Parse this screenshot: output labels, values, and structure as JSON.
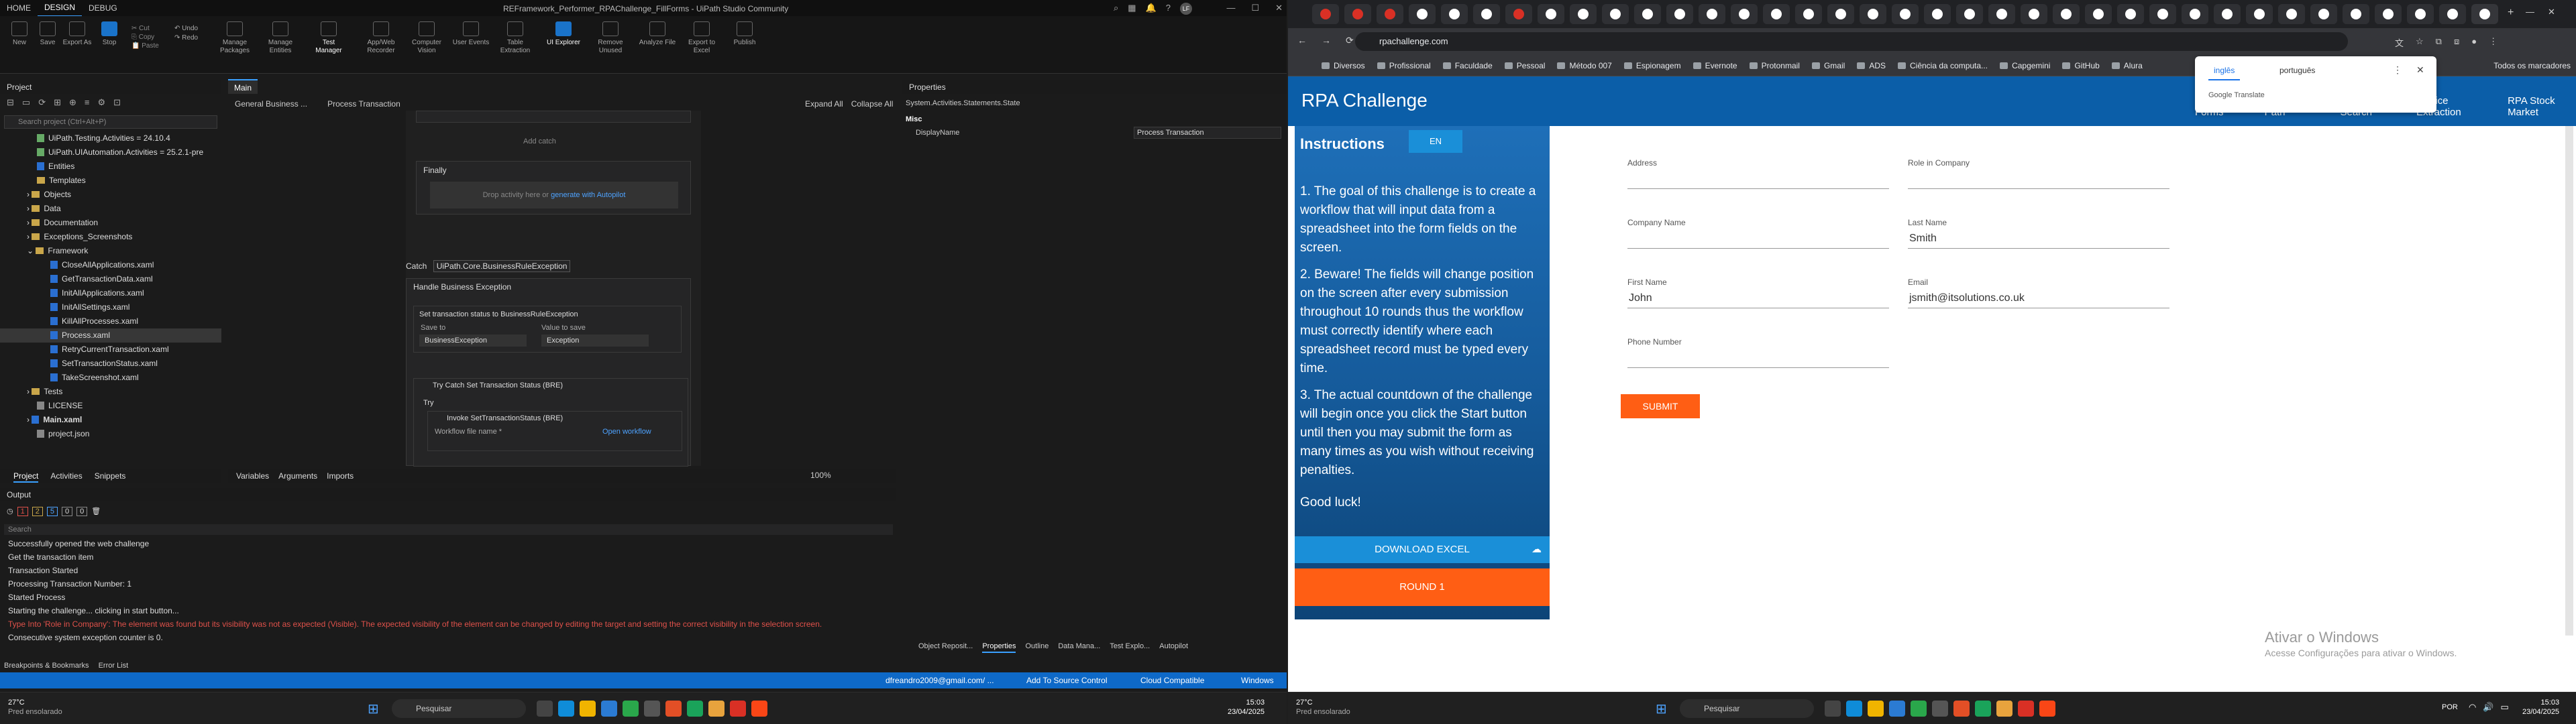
{
  "studio": {
    "menu": [
      "HOME",
      "DESIGN",
      "DEBUG"
    ],
    "title": "REFramework_Performer_RPAChallenge_FillForms - UiPath Studio Community",
    "user_badge": "LF",
    "ribbon": {
      "new": "New",
      "save": "Save",
      "export_as": "Export As",
      "stop": "Stop",
      "cut": "Cut",
      "copy": "Copy",
      "paste": "Paste",
      "undo": "Undo",
      "redo": "Redo",
      "manage_packages": "Manage Packages",
      "manage_entities": "Manage Entities",
      "test_manager": "Test Manager",
      "app_web_recorder": "App/Web Recorder",
      "computer_vision": "Computer Vision",
      "user_events": "User Events",
      "table_extraction": "Table Extraction",
      "ui_explorer": "UI Explorer",
      "remove_unused": "Remove Unused",
      "analyze_file": "Analyze File",
      "export_to_excel": "Export to Excel",
      "publish": "Publish"
    },
    "project": {
      "header": "Project",
      "search_placeholder": "Search project (Ctrl+Alt+P)",
      "items": [
        "UiPath.Testing.Activities = 24.10.4",
        "UiPath.UIAutomation.Activities = 25.2.1-pre",
        "Entities",
        "Templates",
        "Objects",
        "Data",
        "Documentation",
        "Exceptions_Screenshots",
        "Framework",
        "CloseAllApplications.xaml",
        "GetTransactionData.xaml",
        "InitAllApplications.xaml",
        "InitAllSettings.xaml",
        "KillAllProcesses.xaml",
        "Process.xaml",
        "RetryCurrentTransaction.xaml",
        "SetTransactionStatus.xaml",
        "TakeScreenshot.xaml",
        "Tests",
        "LICENSE",
        "Main.xaml",
        "project.json"
      ],
      "bottom_tabs": [
        "Project",
        "Activities",
        "Snippets"
      ]
    },
    "designer": {
      "tab": "Main",
      "breadcrumb": [
        "General Business ...",
        "Process Transaction"
      ],
      "expand_all": "Expand All",
      "collapse_all": "Collapse All",
      "add_catch": "Add catch",
      "finally": "Finally",
      "drop_activity": "Drop activity here or",
      "generate_link": "generate with Autopilot",
      "catch_label": "Catch",
      "catch_exception": "UiPath.Core.BusinessRuleException",
      "handle_business_exception": "Handle Business Exception",
      "set_status_title": "Set transaction status to BusinessRuleException",
      "save_to": "Save to",
      "value_to_save": "Value to save",
      "save_to_value": "BusinessException",
      "value_value": "Exception",
      "try_catch_title": "Try Catch Set Transaction Status (BRE)",
      "try_label": "Try",
      "invoke_title": "Invoke SetTransactionStatus (BRE)",
      "workflow_file_name": "Workflow file name *",
      "open_workflow": "Open workflow",
      "bottom_tabs": [
        "Variables",
        "Arguments",
        "Imports"
      ],
      "zoom": "100%"
    },
    "properties": {
      "header": "Properties",
      "type": "System.Activities.Statements.State",
      "misc": "Misc",
      "display_name_label": "DisplayName",
      "display_name_value": "Process Transaction",
      "bottom_tabs": [
        "Object Reposit...",
        "Properties",
        "Outline",
        "Data Mana...",
        "Test Explo...",
        "Autopilot"
      ]
    },
    "output": {
      "header": "Output",
      "search_placeholder": "Search",
      "counts": [
        "1",
        "2",
        "5",
        "0",
        "0"
      ],
      "lines": [
        {
          "text": "Successfully opened the web challenge",
          "err": false
        },
        {
          "text": "Get the transaction item",
          "err": false
        },
        {
          "text": "Transaction Started",
          "err": false
        },
        {
          "text": "Processing Transaction Number: 1",
          "err": false
        },
        {
          "text": "Started Process",
          "err": false
        },
        {
          "text": "Starting the challenge... clicking in start button...",
          "err": false
        },
        {
          "text": "Type Into 'Role in Company': The element was found but its visibility was not as expected (Visible). The expected visibility of the element can be changed by editing the target and setting the correct visibility in the selection screen.",
          "err": true
        },
        {
          "text": "Consecutive system exception counter is 0.",
          "err": false
        }
      ],
      "bottom_tabs": [
        "Breakpoints & Bookmarks",
        "Error List"
      ]
    },
    "statusbar": {
      "account": "dfreandro2009@gmail.com/ ...",
      "source_control": "Add To Source Control",
      "cloud": "Cloud Compatible",
      "platform": "Windows"
    }
  },
  "taskbar_left": {
    "temp": "27°C",
    "weather": "Pred ensolarado",
    "search": "Pesquisar",
    "time": "15:03",
    "date": "23/04/2025"
  },
  "taskbar_right": {
    "temp": "27°C",
    "weather": "Pred ensolarado",
    "search": "Pesquisar",
    "lang": "POR",
    "time": "15:03",
    "date": "23/04/2025"
  },
  "browser": {
    "url": "rpachallenge.com",
    "bookmarks": [
      "Diversos",
      "Profissional",
      "Faculdade",
      "Pessoal",
      "Método 007",
      "Espionagem",
      "Evernote",
      "Protonmail",
      "Gmail",
      "ADS",
      "Ciência da computa...",
      "Capgemini",
      "GitHub",
      "Alura"
    ],
    "all_bookmarks": "Todos os marcadores",
    "translate": {
      "lang1": "inglês",
      "lang2": "português",
      "brand": "Google Translate"
    },
    "site_title": "RPA Challenge",
    "nav": [
      "Input Forms",
      "Shortest Path",
      "Movie Search",
      "Invoice Extraction",
      "RPA Stock Market"
    ],
    "instructions_title": "Instructions",
    "lang_button": "EN",
    "instructions": [
      "1. The goal of this challenge is to create a workflow that will input data from a spreadsheet into the form fields on the screen.",
      "2. Beware! The fields will change position on the screen after every submission throughout 10 rounds thus the workflow must correctly identify where each spreadsheet record must be typed every time.",
      "3. The actual countdown of the challenge will begin once you click the Start button until then you may submit the form as many times as you wish without receiving penalties.",
      "Good luck!"
    ],
    "download_excel": "DOWNLOAD EXCEL",
    "round": "ROUND 1",
    "form": {
      "address": {
        "label": "Address",
        "value": ""
      },
      "role": {
        "label": "Role in Company",
        "value": ""
      },
      "company": {
        "label": "Company Name",
        "value": ""
      },
      "last_name": {
        "label": "Last Name",
        "value": "Smith"
      },
      "first_name": {
        "label": "First Name",
        "value": "John"
      },
      "email": {
        "label": "Email",
        "value": "jsmith@itsolutions.co.uk"
      },
      "phone": {
        "label": "Phone Number",
        "value": ""
      },
      "submit": "SUBMIT"
    },
    "activate_title": "Ativar o Windows",
    "activate_sub": "Acesse Configurações para ativar o Windows."
  }
}
